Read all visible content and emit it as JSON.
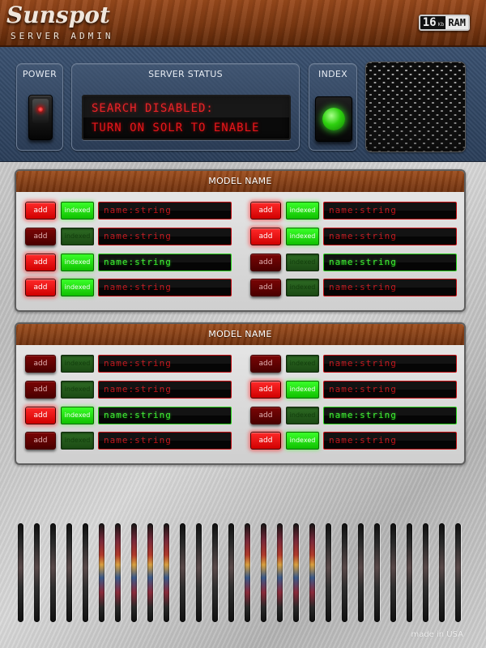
{
  "header": {
    "brand": "Sunspot",
    "subtitle": "SERVER ADMIN",
    "ram": {
      "amount": "16",
      "unit": "Kb",
      "label": "RAM"
    }
  },
  "controls": {
    "power": {
      "title": "POWER",
      "state": "on"
    },
    "status": {
      "title": "SERVER STATUS",
      "line1": "SEARCH DISABLED:",
      "line2": "TURN ON SOLR TO ENABLE"
    },
    "index": {
      "title": "INDEX",
      "state": "on"
    }
  },
  "panels": [
    {
      "title": "MODEL NAME",
      "fields": [
        {
          "add": "add",
          "indexed": "indexed",
          "field": "name:string",
          "add_on": true,
          "indexed_on": true,
          "active": false
        },
        {
          "add": "add",
          "indexed": "indexed",
          "field": "name:string",
          "add_on": true,
          "indexed_on": true,
          "active": false
        },
        {
          "add": "add",
          "indexed": "indexed",
          "field": "name:string",
          "add_on": false,
          "indexed_on": false,
          "active": false
        },
        {
          "add": "add",
          "indexed": "indexed",
          "field": "name:string",
          "add_on": true,
          "indexed_on": true,
          "active": false
        },
        {
          "add": "add",
          "indexed": "indexed",
          "field": "name:string",
          "add_on": true,
          "indexed_on": true,
          "active": true
        },
        {
          "add": "add",
          "indexed": "indexed",
          "field": "name:string",
          "add_on": false,
          "indexed_on": false,
          "active": true
        },
        {
          "add": "add",
          "indexed": "indexed",
          "field": "name:string",
          "add_on": true,
          "indexed_on": true,
          "active": false
        },
        {
          "add": "add",
          "indexed": "indexed",
          "field": "name:string",
          "add_on": false,
          "indexed_on": false,
          "active": false
        }
      ]
    },
    {
      "title": "MODEL NAME",
      "fields": [
        {
          "add": "add",
          "indexed": "indexed",
          "field": "name:string",
          "add_on": false,
          "indexed_on": false,
          "active": false
        },
        {
          "add": "add",
          "indexed": "indexed",
          "field": "name:string",
          "add_on": false,
          "indexed_on": false,
          "active": false
        },
        {
          "add": "add",
          "indexed": "indexed",
          "field": "name:string",
          "add_on": false,
          "indexed_on": false,
          "active": false
        },
        {
          "add": "add",
          "indexed": "indexed",
          "field": "name:string",
          "add_on": true,
          "indexed_on": true,
          "active": false
        },
        {
          "add": "add",
          "indexed": "indexed",
          "field": "name:string",
          "add_on": true,
          "indexed_on": true,
          "active": true
        },
        {
          "add": "add",
          "indexed": "indexed",
          "field": "name:string",
          "add_on": false,
          "indexed_on": false,
          "active": true
        },
        {
          "add": "add",
          "indexed": "indexed",
          "field": "name:string",
          "add_on": false,
          "indexed_on": false,
          "active": false
        },
        {
          "add": "add",
          "indexed": "indexed",
          "field": "name:string",
          "add_on": true,
          "indexed_on": true,
          "active": false
        }
      ]
    }
  ],
  "footer": {
    "made_in": "made in USA"
  },
  "colors": {
    "wood": "#7d3912",
    "steel_blue": "#2b3f5a",
    "led_red": "#e8161b",
    "led_green": "#38f02c"
  }
}
